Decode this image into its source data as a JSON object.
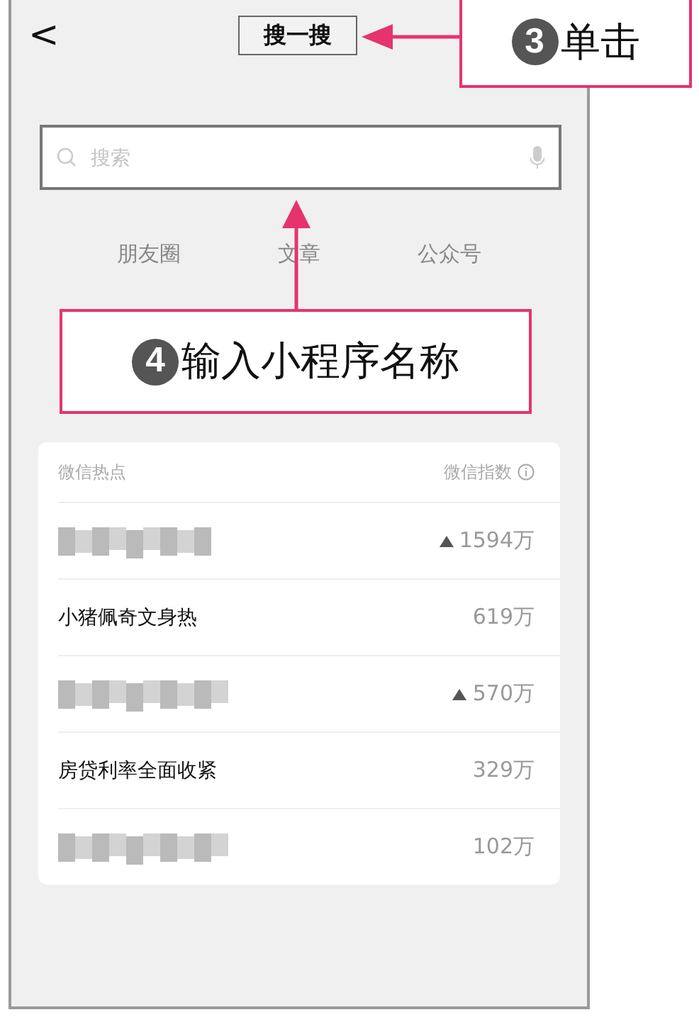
{
  "header": {
    "back": "<",
    "title": "搜一搜"
  },
  "search": {
    "placeholder": "搜索"
  },
  "tabs": [
    {
      "label": "朋友圈"
    },
    {
      "label": "文章"
    },
    {
      "label": "公众号"
    }
  ],
  "callouts": [
    {
      "number": "3",
      "text": "单击",
      "kind": "left"
    },
    {
      "number": "4",
      "text": "输入小程序名称",
      "kind": "up"
    }
  ],
  "hot_list": {
    "title": "微信热点",
    "index_label": "微信指数",
    "rows": [
      {
        "kind": "blurred",
        "value": "1594万",
        "rising": true
      },
      {
        "kind": "text",
        "text": "小猪佩奇文身热",
        "value": "619万",
        "rising": false
      },
      {
        "kind": "blurred",
        "value": "570万",
        "rising": true
      },
      {
        "kind": "text",
        "text": "房贷利率全面收紧",
        "value": "329万",
        "rising": false
      },
      {
        "kind": "blurred",
        "value": "102万",
        "rising": false
      }
    ]
  }
}
